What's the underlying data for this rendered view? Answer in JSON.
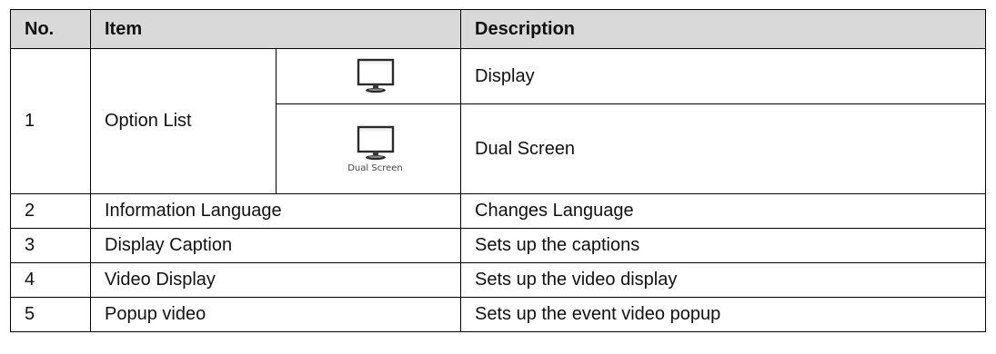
{
  "header": {
    "no": "No.",
    "item": "Item",
    "description": "Description"
  },
  "option_list": {
    "no": "1",
    "item": "Option List",
    "display": {
      "icon": "monitor-icon",
      "description": "Display"
    },
    "dual_screen": {
      "icon": "monitor-icon",
      "icon_caption": "Dual Screen",
      "description": "Dual Screen"
    }
  },
  "rows": [
    {
      "no": "2",
      "item": "Information Language",
      "description": "Changes Language"
    },
    {
      "no": "3",
      "item": "Display Caption",
      "description": "Sets up the captions"
    },
    {
      "no": "4",
      "item": "Video Display",
      "description": "Sets up the video display"
    },
    {
      "no": "5",
      "item": "Popup video",
      "description": "Sets up the event video popup"
    }
  ],
  "colors": {
    "header_background": "#d9d9d9",
    "border": "#000000"
  }
}
